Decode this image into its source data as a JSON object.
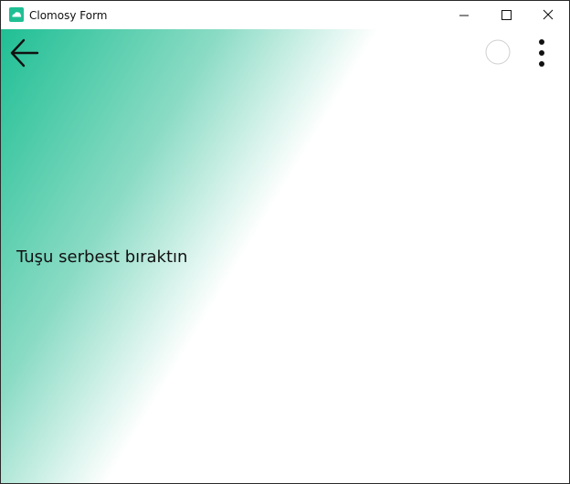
{
  "window": {
    "title": "Clomosy Form",
    "icon": "clomosy-app-icon",
    "controls": {
      "minimize_icon": "minimize-icon",
      "maximize_icon": "maximize-icon",
      "close_icon": "close-icon"
    }
  },
  "toolbar": {
    "back_icon": "arrow-left-icon",
    "circle_icon": "circle-icon",
    "more_icon": "more-vertical-icon"
  },
  "main": {
    "status_text": "Tuşu serbest bıraktın"
  },
  "colors": {
    "gradient_start": "#1fbf94",
    "gradient_end": "#ffffff",
    "app_icon_bg": "#1fbf94"
  }
}
